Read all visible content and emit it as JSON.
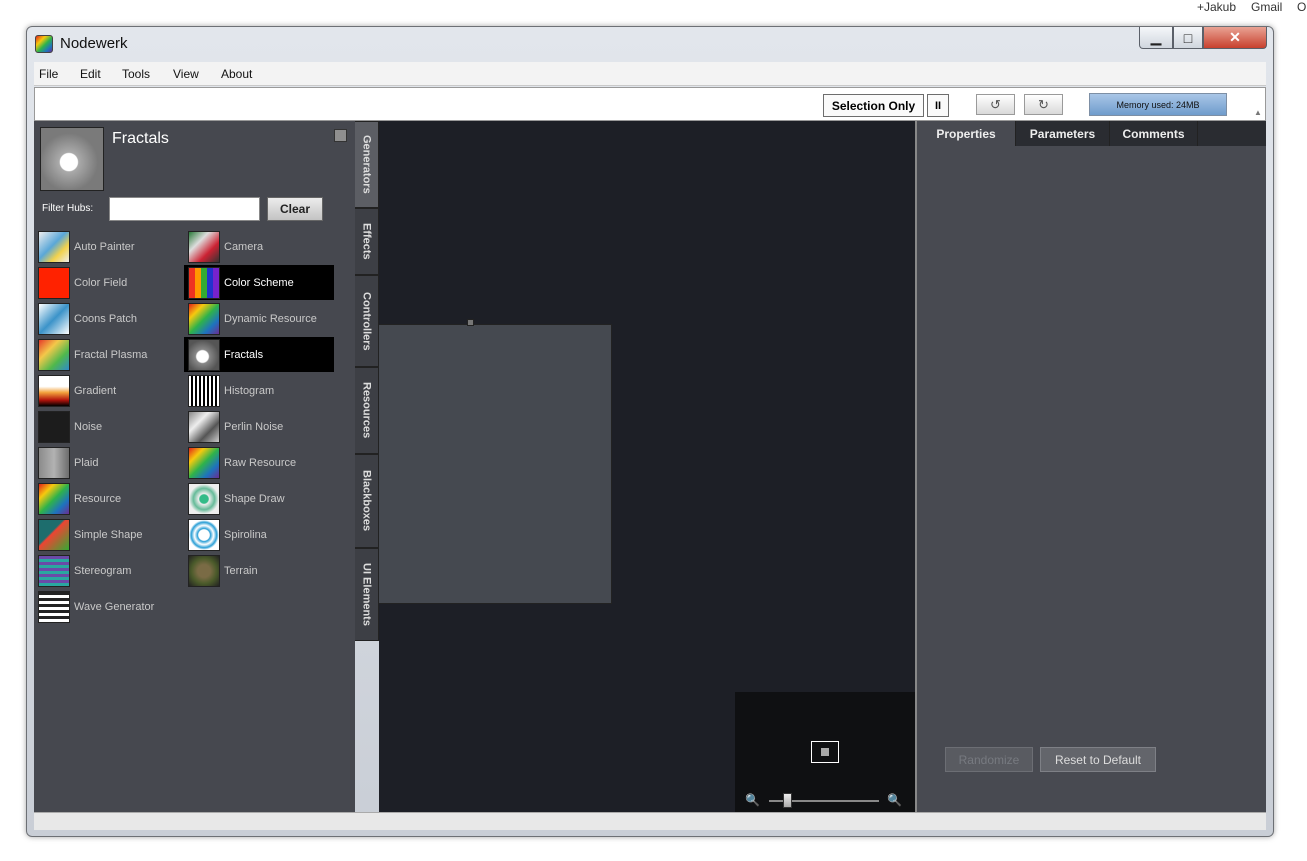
{
  "browser_links": [
    "+Jakub",
    "Gmail",
    "O"
  ],
  "window": {
    "title": "Nodewerk"
  },
  "menu": [
    "File",
    "Edit",
    "Tools",
    "View",
    "About"
  ],
  "toolbar": {
    "selection_only": "Selection Only",
    "pause": "II",
    "memory": "Memory used: 24MB"
  },
  "hub_panel": {
    "title": "Fractals",
    "filter_label": "Filter Hubs:",
    "filter_value": "",
    "clear_label": "Clear",
    "hubs_left": [
      "Auto Painter",
      "Color Field",
      "Coons Patch",
      "Fractal Plasma",
      "Gradient",
      "Noise",
      "Plaid",
      "Resource",
      "Simple Shape",
      "Stereogram",
      "Wave Generator"
    ],
    "hubs_right": [
      "Camera",
      "Color Scheme",
      "Dynamic Resource",
      "Fractals",
      "Histogram",
      "Perlin Noise",
      "Raw Resource",
      "Shape Draw",
      "Spirolina",
      "Terrain"
    ],
    "selected": [
      "Color Scheme",
      "Fractals"
    ]
  },
  "vertical_tabs": [
    "Generators",
    "Effects",
    "Controllers",
    "Resources",
    "Blackboxes",
    "UI Elements"
  ],
  "right_panel": {
    "tabs": [
      "Properties",
      "Parameters",
      "Comments"
    ],
    "randomize": "Randomize",
    "reset": "Reset to Default"
  }
}
